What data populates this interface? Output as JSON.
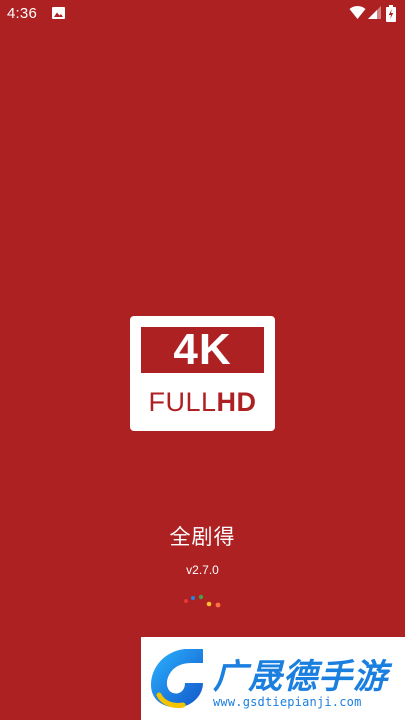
{
  "status_bar": {
    "time": "4:36",
    "icons": [
      "image-icon",
      "wifi-icon",
      "signal-icon",
      "battery-icon"
    ]
  },
  "logo": {
    "main_text": "4K",
    "sub_text_a": "FULL",
    "sub_text_b": "HD"
  },
  "app": {
    "name": "全剧得",
    "version": "v2.7.0"
  },
  "loader": {
    "dot_colors": [
      "#e53935",
      "#1e88e5",
      "#43a047",
      "#fbc02d",
      "#ff7043"
    ]
  },
  "watermark": {
    "title": "广晟德手游",
    "url": "www.gsdtiepianji.com"
  },
  "colors": {
    "background": "#ae2123",
    "watermark_blue": "#1b7fe0"
  }
}
